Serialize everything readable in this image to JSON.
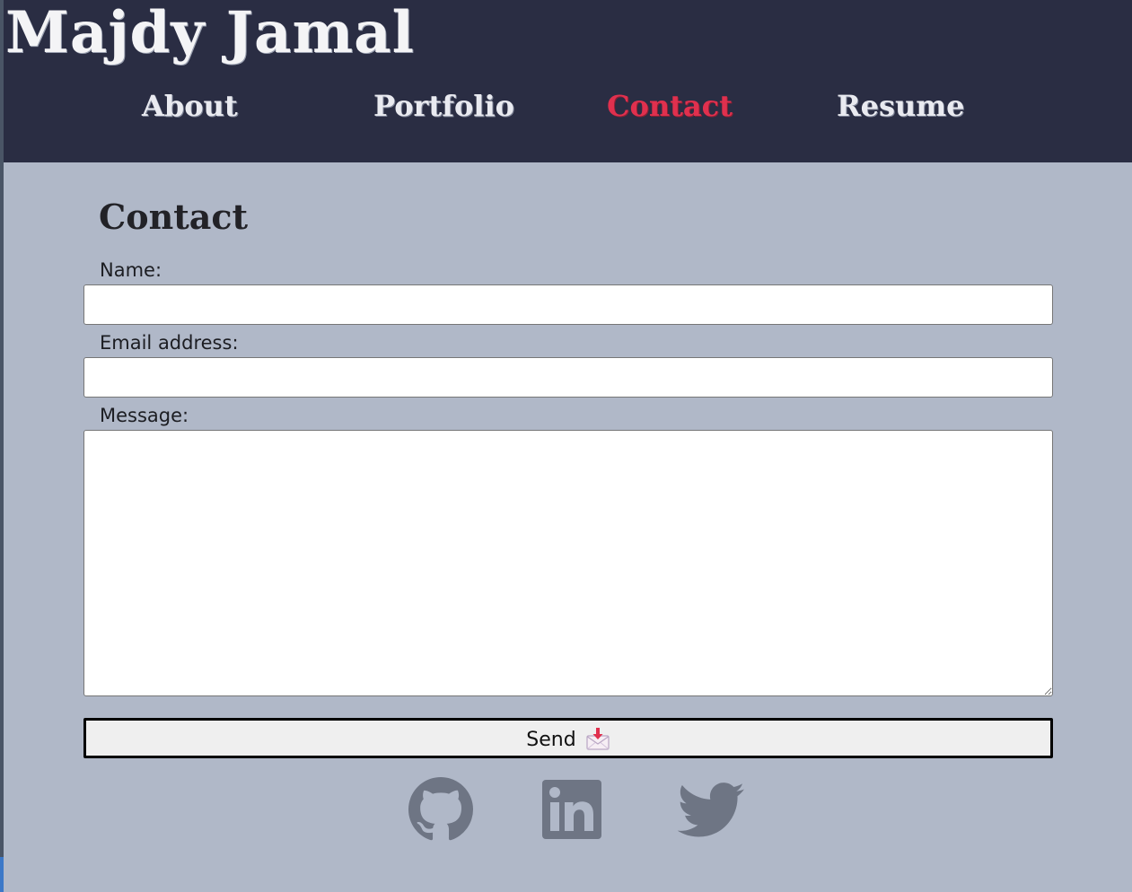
{
  "header": {
    "site_title": "Majdy Jamal",
    "nav": [
      {
        "label": "About",
        "active": false
      },
      {
        "label": "Portfolio",
        "active": false
      },
      {
        "label": "Contact",
        "active": true
      },
      {
        "label": "Resume",
        "active": false
      }
    ]
  },
  "contact_form": {
    "heading": "Contact",
    "name_label": "Name:",
    "name_value": "",
    "email_label": "Email address:",
    "email_value": "",
    "message_label": "Message:",
    "message_value": "",
    "send_label": "Send",
    "send_icon": "envelope-download-icon"
  },
  "social": [
    {
      "name": "GitHub",
      "icon": "github-icon"
    },
    {
      "name": "LinkedIn",
      "icon": "linkedin-icon"
    },
    {
      "name": "Twitter",
      "icon": "twitter-icon"
    }
  ],
  "colors": {
    "header_bg": "#2a2d43",
    "page_bg": "#b0b8c8",
    "active_nav": "#e0304e",
    "nav_text": "#e9eaf0",
    "social_icon": "#6e7584"
  }
}
